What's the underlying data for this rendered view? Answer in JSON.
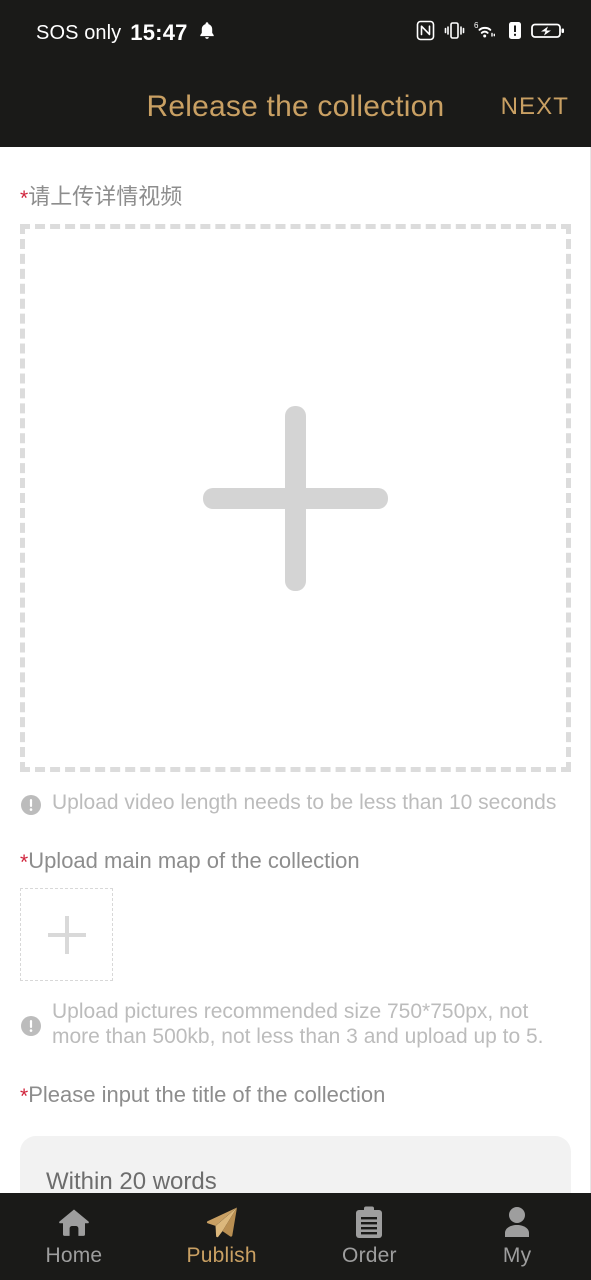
{
  "status_bar": {
    "carrier": "SOS only",
    "time": "15:47",
    "bell_icon": "bell-icon",
    "icons": [
      "nfc-icon",
      "vibrate-icon",
      "wifi-6-icon",
      "alert-icon",
      "battery-charging-icon"
    ]
  },
  "header": {
    "title": "Release the collection",
    "next_label": "NEXT",
    "accent_color": "#c9a063",
    "background_color": "#1a1a18"
  },
  "form": {
    "required_marker": "*",
    "video": {
      "label": "请上传详情视频",
      "dropzone_icon": "plus-icon",
      "hint": "Upload video length needs to be less than 10 seconds",
      "hint_icon": "info-exclamation-icon"
    },
    "main_map": {
      "label": "Upload main map of the collection",
      "dropzone_icon": "plus-icon",
      "hint": "Upload pictures recommended size 750*750px, not more than 500kb, not less than 3 and upload up to 5.",
      "hint_icon": "info-exclamation-icon"
    },
    "title_field": {
      "label": "Please input the title of the collection",
      "placeholder": "Within 20 words",
      "value": ""
    }
  },
  "bottom_nav": {
    "items": [
      {
        "label": "Home",
        "icon": "home-icon",
        "active": false
      },
      {
        "label": "Publish",
        "icon": "paper-plane-icon",
        "active": true
      },
      {
        "label": "Order",
        "icon": "clipboard-icon",
        "active": false
      },
      {
        "label": "My",
        "icon": "person-icon",
        "active": false
      }
    ],
    "active_color": "#c9a063",
    "inactive_color": "#9e9e9e"
  }
}
